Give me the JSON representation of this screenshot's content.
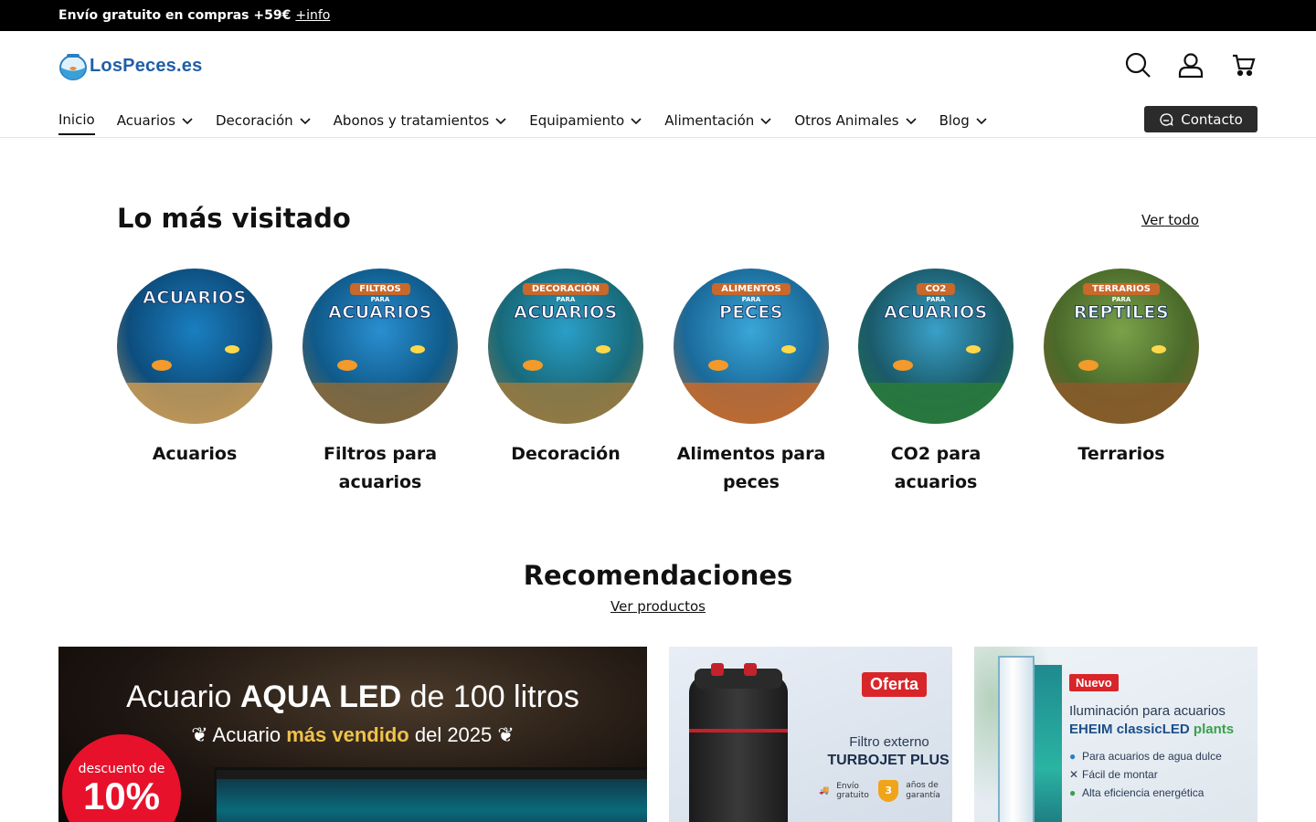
{
  "announcement": {
    "text": "Envío gratuito en compras +59€",
    "link": "+info"
  },
  "brand": {
    "name": "LosPeces",
    "tld": ".es"
  },
  "header_icons": [
    "search-icon",
    "account-icon",
    "cart-icon"
  ],
  "nav": {
    "items": [
      {
        "label": "Inicio",
        "active": true,
        "dropdown": false
      },
      {
        "label": "Acuarios",
        "dropdown": true
      },
      {
        "label": "Decoración",
        "dropdown": true
      },
      {
        "label": "Abonos y tratamientos",
        "dropdown": true
      },
      {
        "label": "Equipamiento",
        "dropdown": true
      },
      {
        "label": "Alimentación",
        "dropdown": true
      },
      {
        "label": "Otros Animales",
        "dropdown": true
      },
      {
        "label": "Blog",
        "dropdown": true
      }
    ],
    "contact_label": "Contacto"
  },
  "most_visited": {
    "title": "Lo más visitado",
    "see_all": "Ver todo",
    "items": [
      {
        "label": "Acuarios",
        "banner_small": "",
        "banner_big": "ACUARIOS",
        "colors": [
          "#1a7fc0",
          "#0d4d7d",
          "#c99a55"
        ]
      },
      {
        "label": "Filtros para acuarios",
        "banner_small": "FILTROS",
        "banner_big": "ACUARIOS",
        "colors": [
          "#2a8fd0",
          "#0f5a8a",
          "#8a6a3a"
        ]
      },
      {
        "label": "Decoración",
        "banner_small": "DECORACIÓN",
        "banner_big": "ACUARIOS",
        "colors": [
          "#2a9fc8",
          "#186a7a",
          "#9a7a40"
        ]
      },
      {
        "label": "Alimentos para peces",
        "banner_small": "ALIMENTOS",
        "banner_big": "PECES",
        "colors": [
          "#3aa6d8",
          "#1a6a9a",
          "#c96a2a"
        ]
      },
      {
        "label": "CO2 para acuarios",
        "banner_small": "CO2",
        "banner_big": "ACUARIOS",
        "colors": [
          "#3aa0c8",
          "#1a5a6a",
          "#2a7a3a"
        ]
      },
      {
        "label": "Terrarios",
        "banner_small": "TERRARIOS",
        "banner_big": "REPTILES",
        "colors": [
          "#7aa24a",
          "#4a6a2a",
          "#8a5a2a"
        ]
      }
    ],
    "para_word": "PARA"
  },
  "recommendations": {
    "title": "Recomendaciones",
    "link": "Ver productos",
    "promo1": {
      "title_pre": "Acuario ",
      "title_bold": "AQUA LED",
      "title_post": " de 100 litros",
      "sub_pre": "Acuario ",
      "sub_gold": "más vendido",
      "sub_post": " del 2025",
      "badge_small": "descuento de",
      "badge_big": "10%"
    },
    "promo2": {
      "tag": "Oferta",
      "line1": "Filtro externo",
      "line2": "TURBOJET PLUS",
      "shipping": "Envío gratuito",
      "warranty_num": "3",
      "warranty_text": "años de garantía"
    },
    "promo3": {
      "tag": "Nuevo",
      "line1": "Iluminación para acuarios",
      "line2_brand": "EHEIM ",
      "line2_product": "classicLED ",
      "line2_green": "plants",
      "features": [
        "Para acuarios de agua dulce",
        "Fácil de montar",
        "Alta eficiencia energética"
      ]
    }
  }
}
